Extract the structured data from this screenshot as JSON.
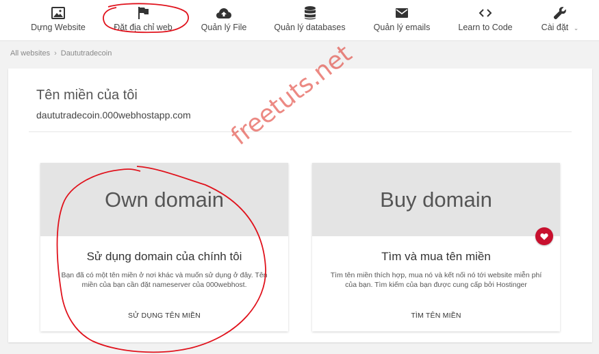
{
  "nav": {
    "items": [
      {
        "label": "Dựng Website",
        "icon": "image-icon"
      },
      {
        "label": "Đặt địa chỉ web",
        "icon": "flag-icon"
      },
      {
        "label": "Quản lý File",
        "icon": "cloud-upload-icon"
      },
      {
        "label": "Quản lý databases",
        "icon": "database-icon"
      },
      {
        "label": "Quản lý emails",
        "icon": "email-icon"
      },
      {
        "label": "Learn to Code",
        "icon": "code-icon"
      },
      {
        "label": "Cài đặt",
        "icon": "wrench-icon"
      }
    ]
  },
  "breadcrumb": {
    "root": "All websites",
    "current": "Daututradecoin"
  },
  "page": {
    "title": "Tên miền của tôi",
    "domain": "daututradecoin.000webhostapp.com"
  },
  "cards": {
    "own": {
      "heading": "Own domain",
      "subtitle": "Sử dụng domain của chính tôi",
      "description": "Bạn đã có một tên miền ở nơi khác và muốn sử dụng ở đây. Tên miền của bạn cần đặt nameserver của 000webhost.",
      "action": "SỬ DỤNG TÊN MIỀN"
    },
    "buy": {
      "heading": "Buy domain",
      "subtitle": "Tìm và mua tên miền",
      "description": "Tìm tên miền thích hợp, mua nó và kết nối nó tới website miễn phí của bạn. Tìm kiếm của bạn được cung cấp bởi Hostinger",
      "action": "TÌM TÊN MIỀN"
    }
  },
  "watermark": "freetuts.net",
  "colors": {
    "accent_red": "#c8102e",
    "annotation_red": "#e0121c",
    "card_header": "#e4e4e4"
  }
}
